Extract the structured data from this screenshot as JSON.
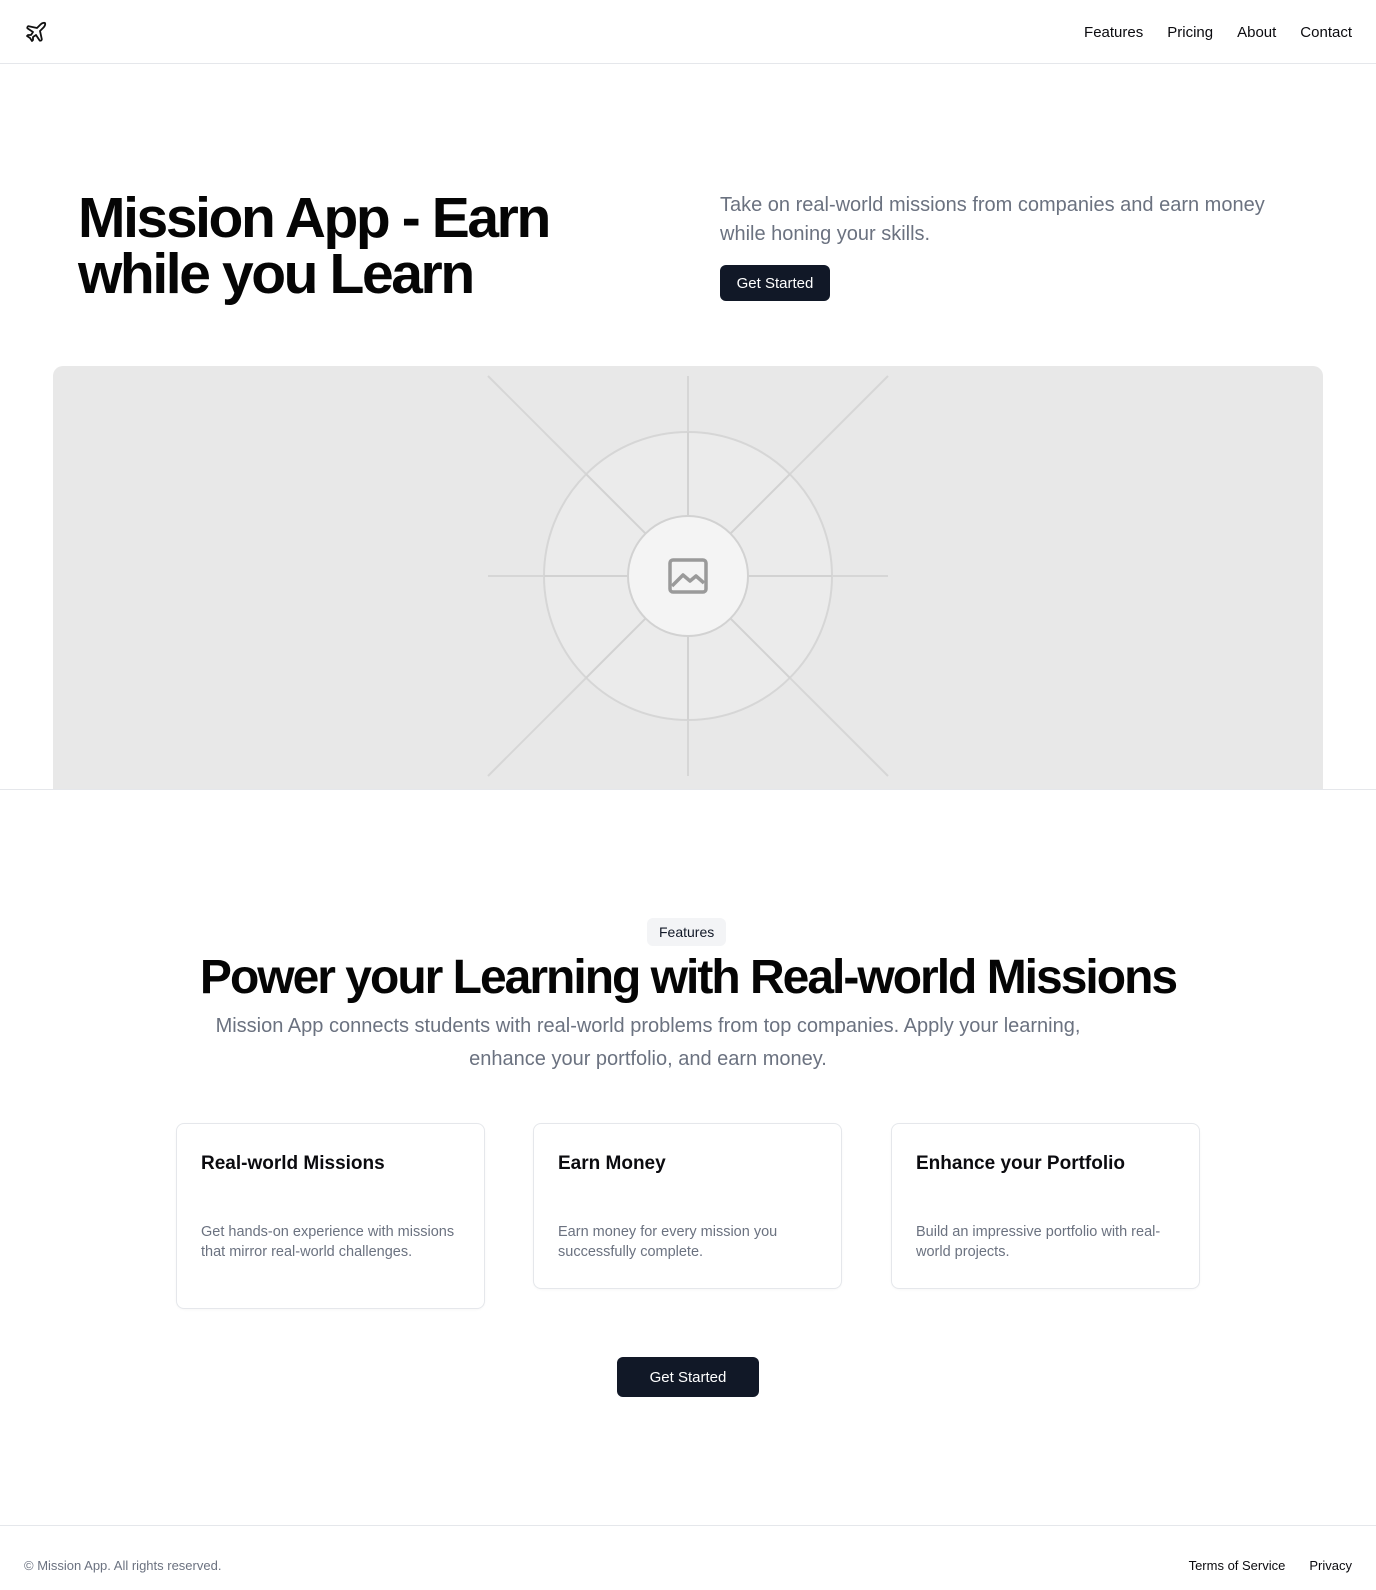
{
  "header": {
    "logo_icon": "plane-icon",
    "nav": [
      {
        "label": "Features"
      },
      {
        "label": "Pricing"
      },
      {
        "label": "About"
      },
      {
        "label": "Contact"
      }
    ]
  },
  "hero": {
    "title": "Mission App - Earn while you Learn",
    "subtitle": "Take on real-world missions from companies and earn money while honing your skills.",
    "cta_label": "Get Started",
    "image_icon": "image-placeholder-icon"
  },
  "features": {
    "badge": "Features",
    "title": "Power your Learning with Real-world Missions",
    "subtitle": "Mission App connects students with real-world problems from top companies. Apply your learning, enhance your portfolio, and earn money.",
    "cards": [
      {
        "title": "Real-world Missions",
        "description": "Get hands-on experience with missions that mirror real-world challenges."
      },
      {
        "title": "Earn Money",
        "description": "Earn money for every mission you successfully complete."
      },
      {
        "title": "Enhance your Portfolio",
        "description": "Build an impressive portfolio with real-world projects."
      }
    ],
    "cta_label": "Get Started"
  },
  "footer": {
    "copyright": "© Mission App. All rights reserved.",
    "links": [
      {
        "label": "Terms of Service"
      },
      {
        "label": "Privacy"
      }
    ]
  },
  "colors": {
    "button_bg": "#111827",
    "muted_text": "#6b7280",
    "border": "#e5e7eb",
    "placeholder_bg": "#e8e8e8"
  }
}
